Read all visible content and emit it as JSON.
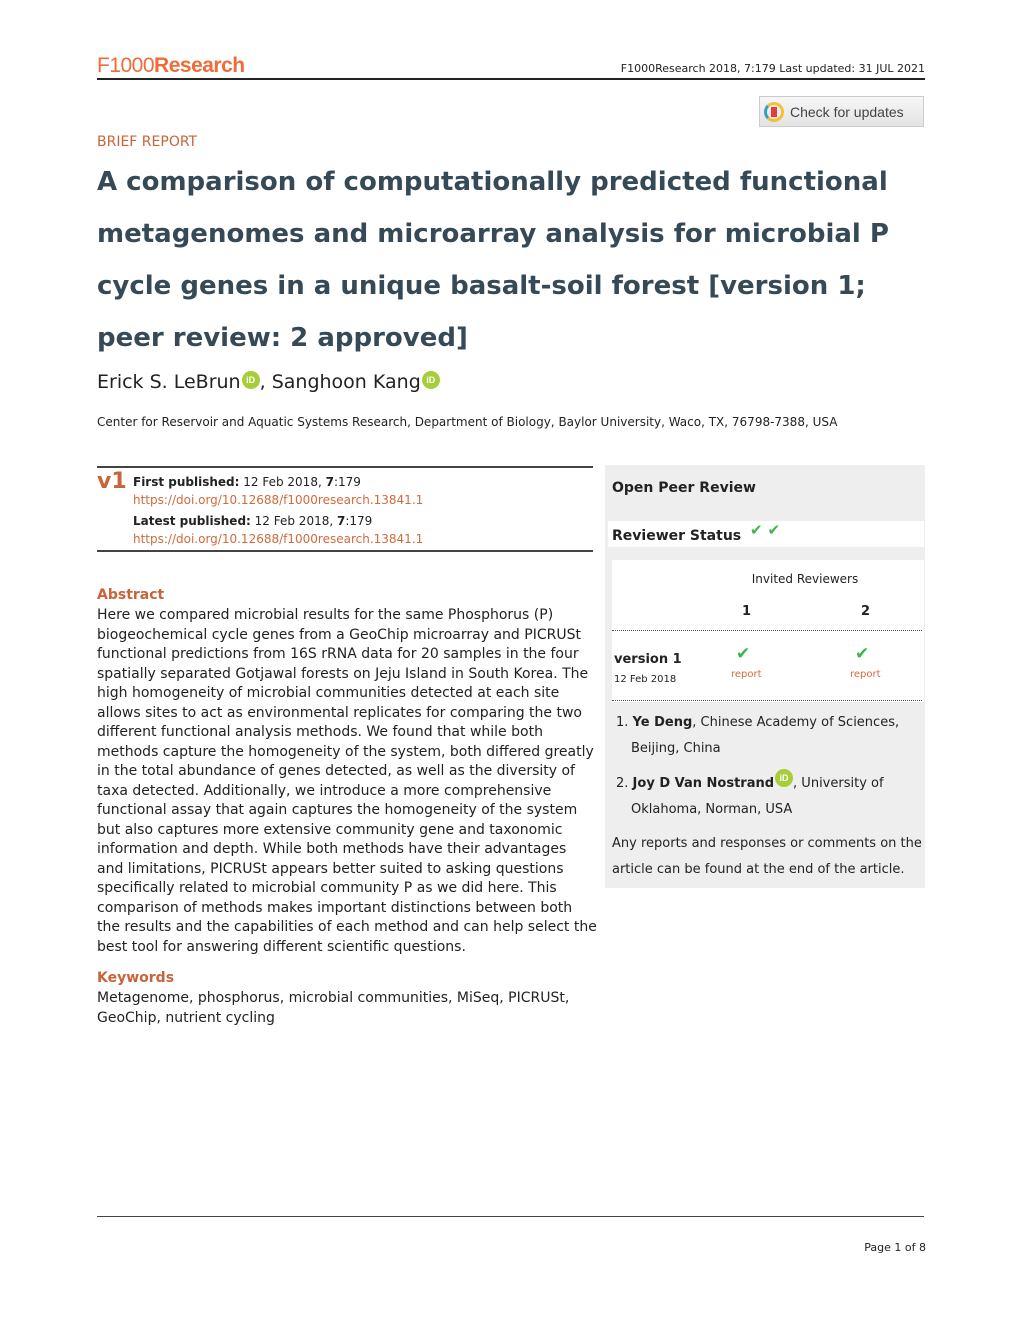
{
  "header": {
    "logo_left": "F1000",
    "logo_right": "Research",
    "citation": "F1000Research 2018, 7:179 Last updated: 31 JUL 2021",
    "check_updates_label": "Check for updates"
  },
  "article": {
    "type": "BRIEF REPORT",
    "title": "A comparison of computationally predicted functional metagenomes and microarray analysis for microbial P cycle genes in a unique basalt-soil forest",
    "version_note": "[version 1; peer review: 2 approved]",
    "authors": [
      {
        "name": "Erick S. LeBrun",
        "orcid": "iD"
      },
      {
        "name": "Sanghoon Kang",
        "orcid": "iD"
      }
    ],
    "author_separator": ", ",
    "affiliation": "Center for Reservoir and Aquatic Systems Research, Department of Biology, Baylor University, Waco, TX, 76798-7388, USA"
  },
  "publication": {
    "version_badge": "v1",
    "first_label": "First published:",
    "first_date": " 12 Feb 2018, ",
    "first_volume": "7",
    "first_article": ":179",
    "first_doi": "https://doi.org/10.12688/f1000research.13841.1",
    "latest_label": "Latest published:",
    "latest_date": " 12 Feb 2018, ",
    "latest_volume": "7",
    "latest_article": ":179",
    "latest_doi": "https://doi.org/10.12688/f1000research.13841.1"
  },
  "abstract": {
    "heading": "Abstract",
    "text": "Here we compared microbial results for the same Phosphorus (P) biogeochemical cycle genes from a GeoChip microarray and PICRUSt functional predictions from 16S rRNA data for 20 samples in the four spatially separated Gotjawal forests on Jeju Island in South Korea. The high homogeneity of microbial communities detected at each site allows sites to act as environmental replicates for comparing the two different functional analysis methods. We found that while both methods capture the homogeneity of the system, both differed greatly in the total abundance of genes detected, as well as the diversity of taxa detected. Additionally, we introduce a more comprehensive functional assay that again captures the homogeneity of the system but also captures more extensive community gene and taxonomic information and depth. While both methods have their advantages and limitations, PICRUSt appears better suited to asking questions specifically related to microbial community P as we did here. This comparison of methods makes important distinctions between both the results and the capabilities of each method and can help select the best tool for answering different scientific questions."
  },
  "keywords": {
    "heading": "Keywords",
    "text": "Metagenome, phosphorus, microbial communities, MiSeq, PICRUSt, GeoChip, nutrient cycling"
  },
  "peer_review": {
    "title": "Open Peer Review",
    "status_label": "Reviewer Status",
    "status_icons": [
      "✔",
      "✔"
    ],
    "invited_label": "Invited Reviewers",
    "columns": [
      "1",
      "2"
    ],
    "version_label": "version 1",
    "version_date": "12 Feb 2018",
    "verdicts": [
      {
        "icon": "✔",
        "link": "report"
      },
      {
        "icon": "✔",
        "link": "report"
      }
    ],
    "reviewers": [
      {
        "num": "1.",
        "name": "Ye Deng",
        "affiliation_1": ", Chinese Academy of Sciences,",
        "affiliation_2": "Beijing, China"
      },
      {
        "num": "2.",
        "name": "Joy D Van Nostrand",
        "orcid": "iD",
        "affiliation_1": ", University of",
        "affiliation_2": "Oklahoma, Norman, USA"
      }
    ],
    "note": "Any reports and responses or comments on the article can be found at the end of the article."
  },
  "footer": {
    "page": "Page 1 of 8"
  },
  "colors": {
    "accent": "#c8643a",
    "title": "#364957",
    "approved": "#3cb54a",
    "orcid": "#a6ce39",
    "panel_bg": "#eeeeee"
  }
}
